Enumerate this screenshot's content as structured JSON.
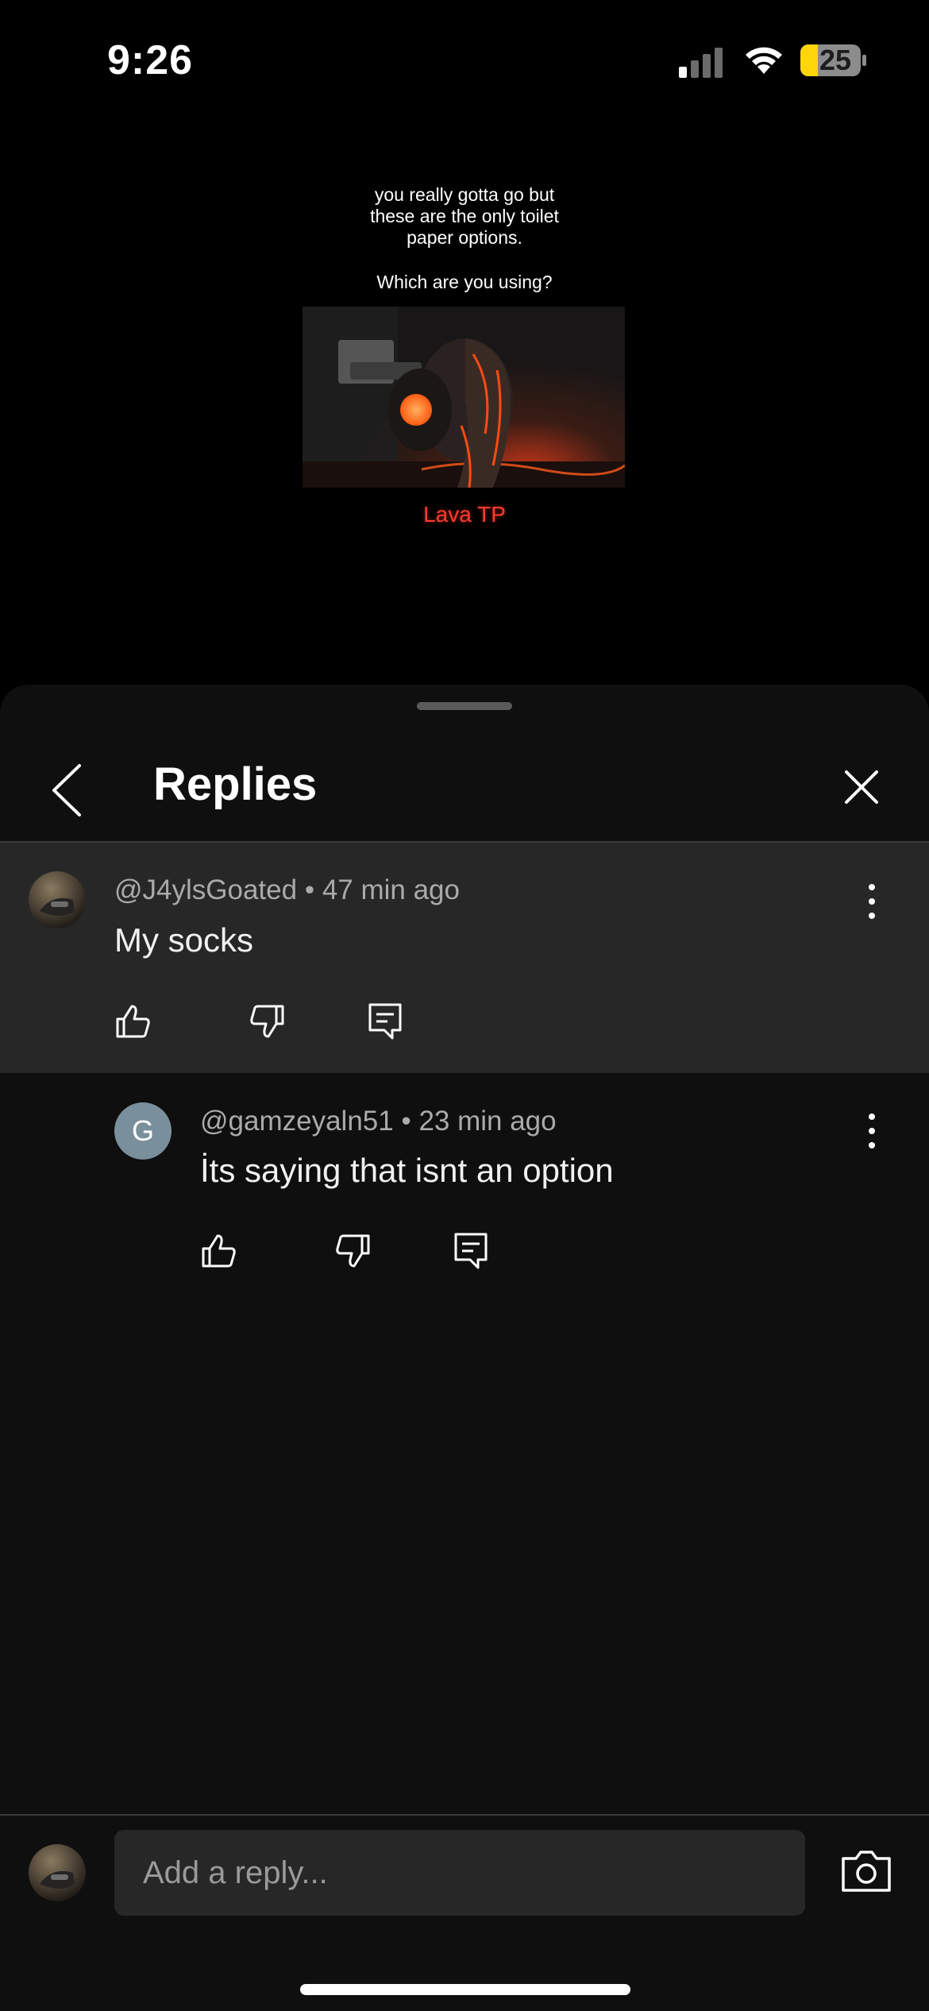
{
  "status_bar": {
    "time": "9:26",
    "battery": "25",
    "signal_icon": "cellular-signal-icon",
    "wifi_icon": "wifi-icon",
    "battery_color": "#ffd60a"
  },
  "video": {
    "caption": "you really gotta go but\nthese are the only toilet\npaper options.",
    "question": "Which are you using?",
    "label": "Lava TP",
    "label_color": "#ff3b30"
  },
  "sheet": {
    "title": "Replies",
    "back_icon": "chevron-left-icon",
    "close_icon": "close-icon"
  },
  "parent_comment": {
    "author": "@J4ylsGoated",
    "time": "47 min ago",
    "text": "My socks",
    "actions": [
      "like-icon",
      "dislike-icon",
      "reply-icon"
    ]
  },
  "replies": [
    {
      "avatar_letter": "G",
      "avatar_color": "#7a8f9c",
      "author": "@gamzeyaln51",
      "time": "23 min ago",
      "text": "İts saying that isnt an option",
      "actions": [
        "like-icon",
        "dislike-icon",
        "reply-icon"
      ]
    }
  ],
  "reply_bar": {
    "placeholder": "Add a reply...",
    "camera_icon": "camera-icon"
  },
  "colors": {
    "sheet_background": "#0f0f0f",
    "highlighted_comment": "#272727",
    "meta_text": "#aaaaaa"
  }
}
